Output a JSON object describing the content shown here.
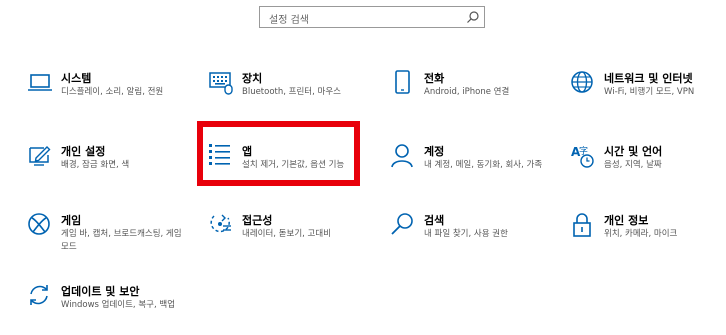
{
  "search": {
    "placeholder": "설정 검색"
  },
  "tiles": [
    {
      "title": "시스템",
      "desc": "디스플레이, 소리, 알림, 전원",
      "icon": "laptop-icon"
    },
    {
      "title": "장치",
      "desc": "Bluetooth, 프린터, 마우스",
      "icon": "keyboard-icon"
    },
    {
      "title": "전화",
      "desc": "Android, iPhone 연결",
      "icon": "phone-icon"
    },
    {
      "title": "네트워크 및 인터넷",
      "desc": "Wi-Fi, 비행기 모드, VPN",
      "icon": "globe-icon"
    },
    {
      "title": "개인 설정",
      "desc": "배경, 잠금 화면, 색",
      "icon": "personalize-pen-icon"
    },
    {
      "title": "앱",
      "desc": "설치 제거, 기본값, 옵션 기능",
      "icon": "apps-list-icon"
    },
    {
      "title": "계정",
      "desc": "내 계정, 메일, 동기화, 회사, 가족",
      "icon": "person-icon"
    },
    {
      "title": "시간 및 언어",
      "desc": "음성, 지역, 날짜",
      "icon": "time-language-icon"
    },
    {
      "title": "게임",
      "desc": "게임 바, 캡처, 브로드캐스팅, 게임 모드",
      "icon": "xbox-icon"
    },
    {
      "title": "접근성",
      "desc": "내레이터, 돋보기, 고대비",
      "icon": "accessibility-icon"
    },
    {
      "title": "검색",
      "desc": "내 파일 찾기, 사용 권한",
      "icon": "search-icon"
    },
    {
      "title": "개인 정보",
      "desc": "위치, 카메라, 마이크",
      "icon": "lock-icon"
    },
    {
      "title": "업데이트 및 보안",
      "desc": "Windows 업데이트, 복구, 백업",
      "icon": "sync-icon"
    }
  ],
  "colors": {
    "accent": "#0063b1",
    "highlight": "#e8000b"
  }
}
